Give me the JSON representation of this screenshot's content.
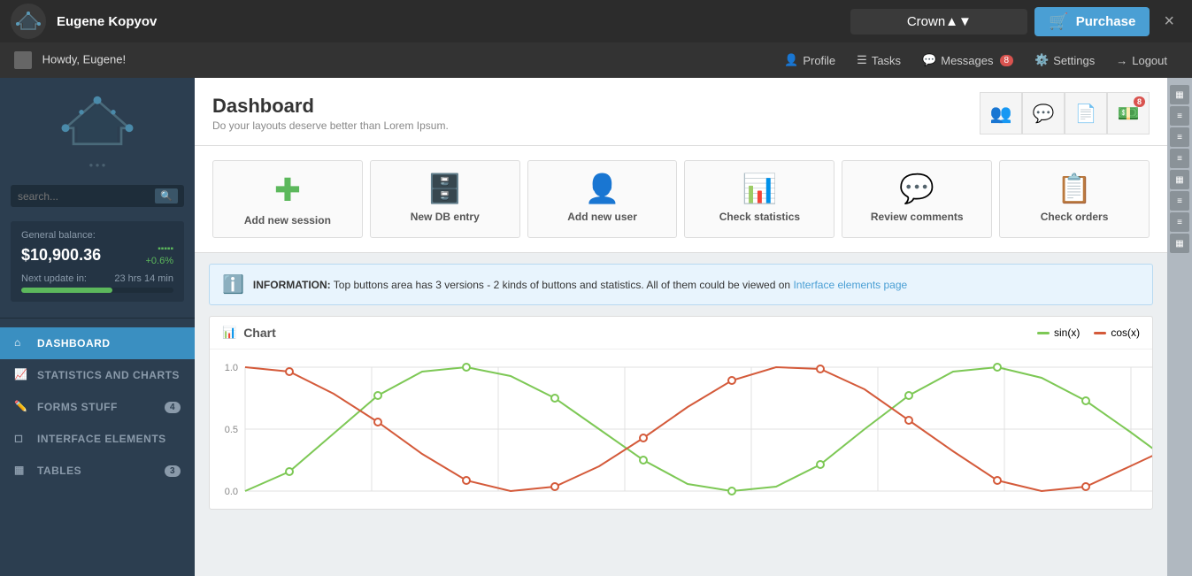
{
  "topbar": {
    "username": "Eugene Kopyov",
    "crown_label": "Crown",
    "purchase_label": "Purchase",
    "close_label": "×"
  },
  "secnav": {
    "greeting": "Howdy, Eugene!",
    "profile": "Profile",
    "tasks": "Tasks",
    "messages": "Messages",
    "messages_count": "8",
    "settings": "Settings",
    "logout": "Logout"
  },
  "sidebar": {
    "search_placeholder": "search...",
    "balance_label": "General balance:",
    "balance_amount": "$10,900.36",
    "balance_change": "+0.6%",
    "next_update_label": "Next update in:",
    "next_update_time": "23 hrs  14 min",
    "nav_items": [
      {
        "id": "dashboard",
        "label": "Dashboard",
        "badge": null,
        "active": true
      },
      {
        "id": "statistics",
        "label": "Statistics and Charts",
        "badge": null,
        "active": false
      },
      {
        "id": "forms",
        "label": "Forms Stuff",
        "badge": "4",
        "active": false
      },
      {
        "id": "interface",
        "label": "Interface Elements",
        "badge": null,
        "active": false
      },
      {
        "id": "tables",
        "label": "Tables",
        "badge": "3",
        "active": false
      }
    ]
  },
  "dashboard": {
    "title": "Dashboard",
    "subtitle": "Do your layouts deserve better than Lorem Ipsum.",
    "actions": [
      {
        "id": "add-session",
        "label": "Add new session",
        "icon": "➕"
      },
      {
        "id": "new-db",
        "label": "New DB entry",
        "icon": "🗄️"
      },
      {
        "id": "add-user",
        "label": "Add new user",
        "icon": "👤"
      },
      {
        "id": "check-stats",
        "label": "Check statistics",
        "icon": "📊"
      },
      {
        "id": "review-comments",
        "label": "Review comments",
        "icon": "💬"
      },
      {
        "id": "check-orders",
        "label": "Check orders",
        "icon": "📋"
      }
    ],
    "info_prefix": "INFORMATION:",
    "info_text": " Top buttons area has 3 versions - 2 kinds of buttons and statistics. All of them could be viewed on ",
    "info_link": "Interface elements page",
    "chart_title": "Chart",
    "legend_sin": "sin(x)",
    "legend_cos": "cos(x)",
    "chart_colors": {
      "sin": "#7dc855",
      "cos": "#d45a3a"
    },
    "y_labels": [
      "1.0",
      "0.5",
      "0.0"
    ],
    "header_icons": [
      {
        "id": "users-icon",
        "symbol": "👥"
      },
      {
        "id": "comments-icon",
        "symbol": "💬"
      },
      {
        "id": "docs-icon",
        "symbol": "📄"
      },
      {
        "id": "money-icon",
        "symbol": "💵",
        "badge": "8"
      }
    ]
  }
}
